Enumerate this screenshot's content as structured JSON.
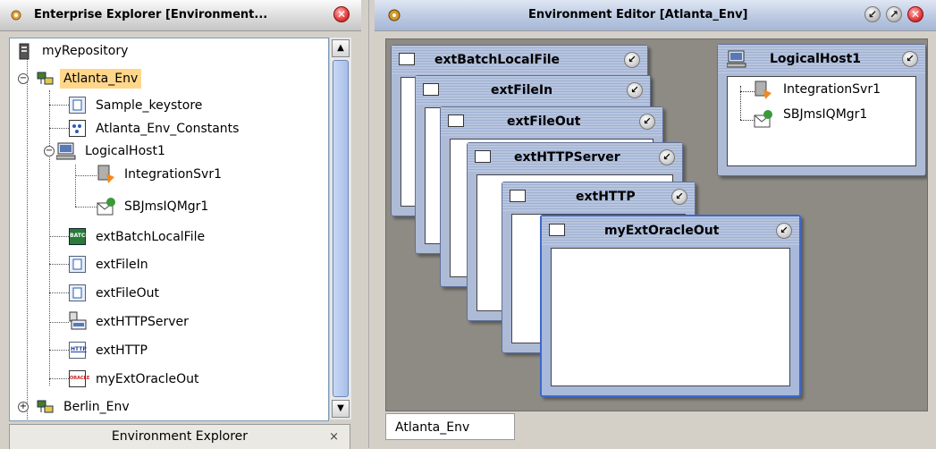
{
  "left_panel": {
    "title": "Enterprise Explorer [Environment...",
    "bottom_tab": "Environment Explorer",
    "bottom_tab_close": "×",
    "close_icon": "close-icon"
  },
  "tree": {
    "items": [
      {
        "label": "myRepository",
        "icon": "repository-icon"
      },
      {
        "label": "Atlanta_Env",
        "icon": "environment-icon",
        "selected": true
      },
      {
        "label": "Sample_keystore",
        "icon": "keystore-icon"
      },
      {
        "label": "Atlanta_Env_Constants",
        "icon": "constants-icon"
      },
      {
        "label": "LogicalHost1",
        "icon": "logical-host-icon"
      },
      {
        "label": "IntegrationSvr1",
        "icon": "integration-server-icon"
      },
      {
        "label": "SBJmsIQMgr1",
        "icon": "jms-manager-icon"
      },
      {
        "label": "extBatchLocalFile",
        "icon": "batch-icon",
        "icon_text": "BATCH"
      },
      {
        "label": "extFileIn",
        "icon": "file-icon"
      },
      {
        "label": "extFileOut",
        "icon": "file-icon"
      },
      {
        "label": "extHTTPServer",
        "icon": "http-server-icon"
      },
      {
        "label": "extHTTP",
        "icon": "http-icon",
        "icon_text": "HTTP"
      },
      {
        "label": "myExtOracleOut",
        "icon": "oracle-icon",
        "icon_text": "ORACLE"
      },
      {
        "label": "Berlin_Env",
        "icon": "environment-icon"
      }
    ]
  },
  "right_panel": {
    "title": "Environment Editor [Atlanta_Env]",
    "bottom_tab": "Atlanta_Env"
  },
  "windows": [
    {
      "title": "extBatchLocalFile"
    },
    {
      "title": "extFileIn"
    },
    {
      "title": "extFileOut"
    },
    {
      "title": "extHTTPServer"
    },
    {
      "title": "extHTTP"
    },
    {
      "title": "myExtOracleOut"
    },
    {
      "title": "LogicalHost1",
      "items": [
        "IntegrationSvr1",
        "SBJmsIQMgr1"
      ]
    }
  ],
  "colors": {
    "selection": "#ffd68a",
    "window_frame": "#5f6f94",
    "canvas": "#8e8b85"
  }
}
